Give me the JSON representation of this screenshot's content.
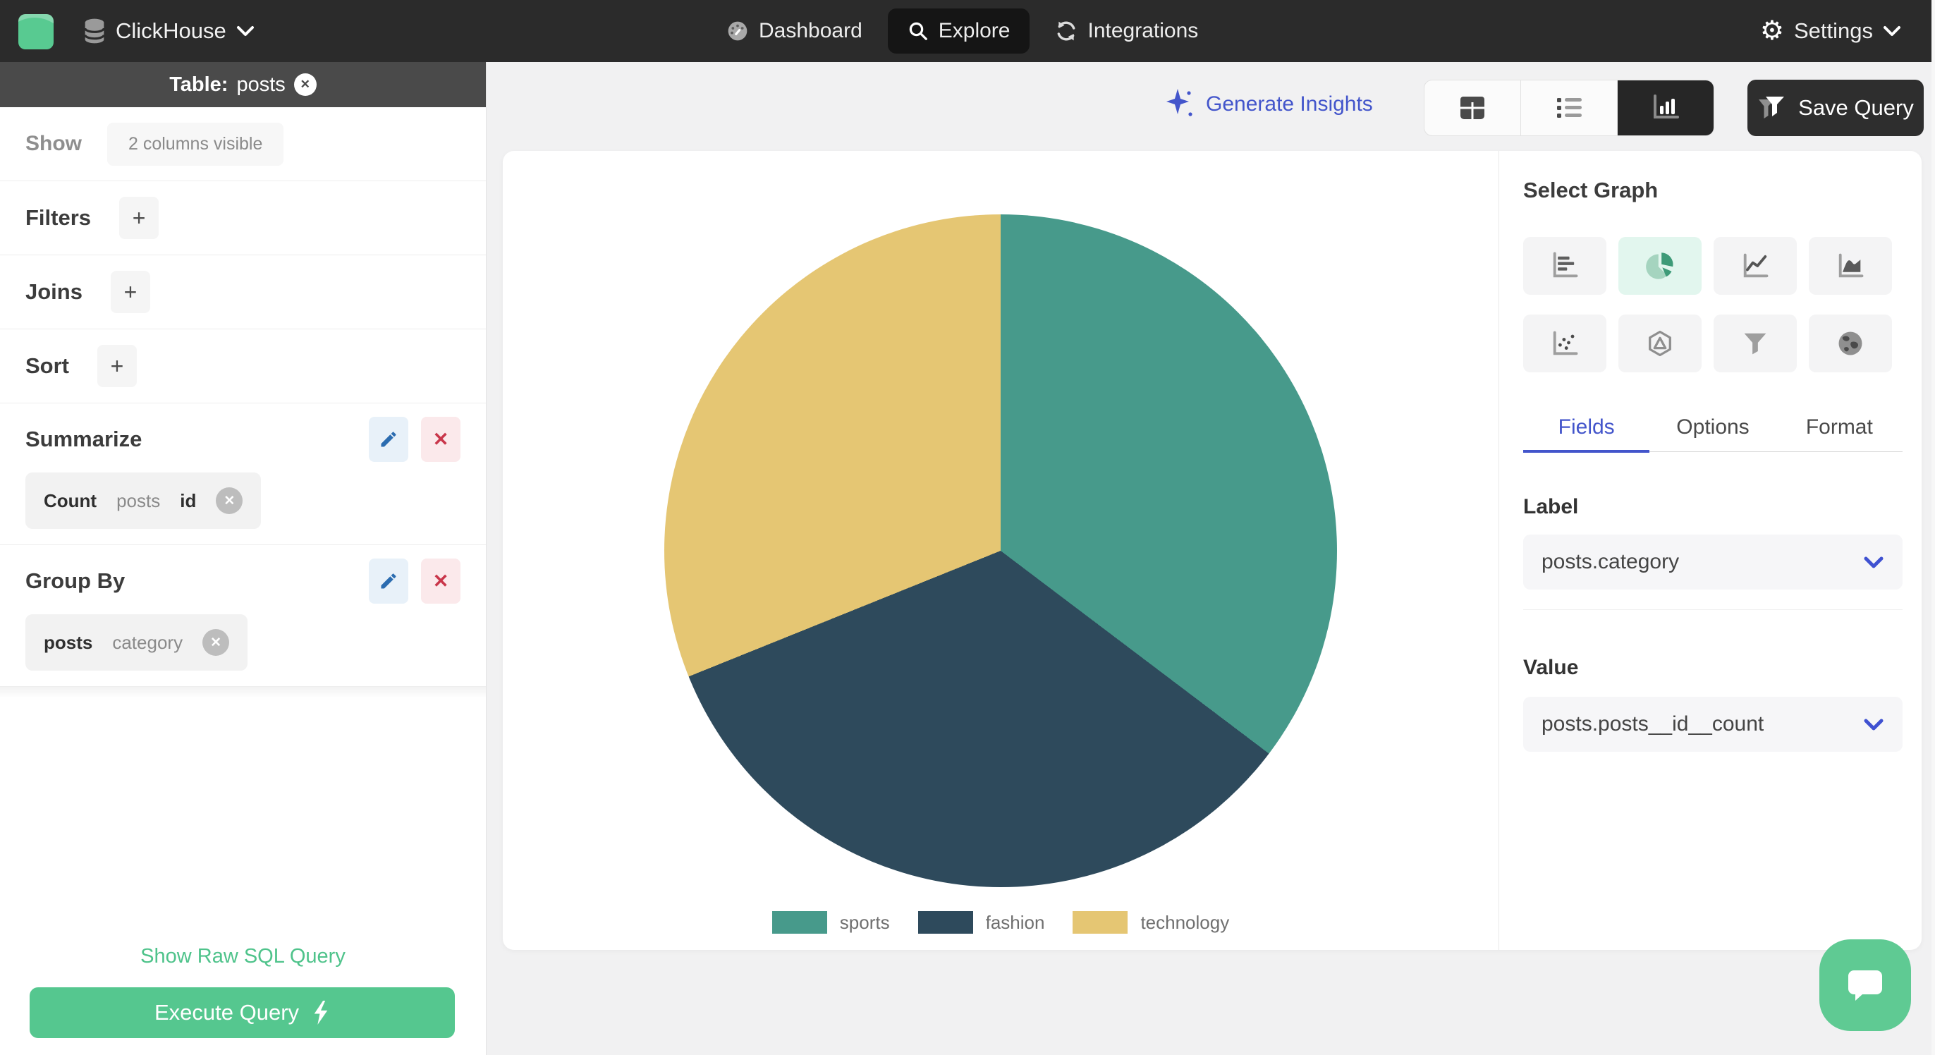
{
  "navbar": {
    "brand": "ClickHouse",
    "nav": [
      {
        "label": "Dashboard",
        "active": false
      },
      {
        "label": "Explore",
        "active": true
      },
      {
        "label": "Integrations",
        "active": false
      }
    ],
    "settings": "Settings"
  },
  "sidebar": {
    "table_label": "Table:",
    "table_name": "posts",
    "show_label": "Show",
    "columns_pill": "2 columns visible",
    "filters_label": "Filters",
    "joins_label": "Joins",
    "sort_label": "Sort",
    "add_symbol": "+",
    "summarize_label": "Summarize",
    "summarize_chip": {
      "agg": "Count",
      "table": "posts",
      "column": "id"
    },
    "group_by_label": "Group By",
    "group_by_chip": {
      "table": "posts",
      "column": "category"
    },
    "raw_sql_link": "Show Raw SQL Query",
    "execute_button": "Execute Query"
  },
  "toolbar": {
    "generate_insights": "Generate Insights",
    "save_query": "Save Query"
  },
  "graph_panel": {
    "title": "Select Graph",
    "selected_graph": "pie",
    "graph_types": [
      "bar",
      "pie",
      "line",
      "area",
      "scatter",
      "polygon",
      "funnel",
      "map"
    ],
    "tabs": [
      {
        "label": "Fields",
        "active": true
      },
      {
        "label": "Options",
        "active": false
      },
      {
        "label": "Format",
        "active": false
      }
    ],
    "label_heading": "Label",
    "label_value": "posts.category",
    "value_heading": "Value",
    "value_value": "posts.posts__id__count"
  },
  "chart_data": {
    "type": "pie",
    "title": "",
    "labels": [
      "sports",
      "fashion",
      "technology"
    ],
    "values": [
      35.3,
      33.6,
      31.1
    ],
    "value_note": "percent shares estimated from slice angles (127deg, 121deg, 112deg); counts of posts.id grouped by posts.category",
    "colors": [
      "#479a8b",
      "#2e4a5c",
      "#e5c673"
    ],
    "start_angle_deg": 0,
    "clockwise": true,
    "legend_position": "bottom",
    "legend_entries": [
      "sports",
      "fashion",
      "technology"
    ]
  },
  "colors": {
    "accent_green": "#55c78f",
    "accent_blue": "#4355cb",
    "navbar_bg": "#2b2b2b",
    "sidebar_header_bg": "#4a4a4a",
    "active_graph_bg": "#e2f6ee",
    "edit_blue": "#2b6cb0",
    "delete_red": "#c9364a"
  }
}
